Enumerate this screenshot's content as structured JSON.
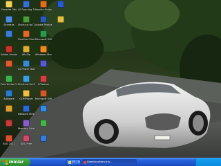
{
  "colors": {
    "taskbar": "#245edb",
    "start": "#3a9b3a",
    "tray": "#0c8ae0",
    "car": "#dcdcdc"
  },
  "desktop": {
    "icons": [
      {
        "label": "Favorite 08x",
        "icon": "folder-icon",
        "color": "#f3d35a"
      },
      {
        "label": "Secretos",
        "icon": "app-icon",
        "color": "#4a8de0"
      },
      {
        "label": "",
        "icon": "internet-explorer-icon",
        "color": "#3b7bd8"
      },
      {
        "label": "Adobe Acrobat 6 Professional",
        "icon": "acrobat-icon",
        "color": "#d0302a"
      },
      {
        "label": "",
        "icon": "app-icon",
        "color": "#e05a2a"
      },
      {
        "label": "Free Audio Converter",
        "icon": "audio-icon",
        "color": "#3bb24a"
      },
      {
        "label": "AdAware",
        "icon": "shield-icon",
        "color": "#2a7bd0"
      },
      {
        "label": "",
        "icon": "app-icon",
        "color": "#e0a030"
      },
      {
        "label": "",
        "icon": "app-icon",
        "color": "#c83a3a"
      },
      {
        "label": "AVG 2011",
        "icon": "avg-icon",
        "color": "#e05030"
      },
      {
        "label": "LS Running Tool",
        "icon": "tool-icon",
        "color": "#3a6fd0"
      },
      {
        "label": "Shortcut to QuickBook",
        "icon": "shortcut-icon",
        "color": "#4a9a3a"
      },
      {
        "label": "FlexSim Client",
        "icon": "app-icon",
        "color": "#e06a2a"
      },
      {
        "label": "WinZip",
        "icon": "winzip-icon",
        "color": "#d8b030"
      },
      {
        "label": "LS Power Tools",
        "icon": "tool-icon",
        "color": "#3a8ad0"
      },
      {
        "label": "Shortcut to MessengerSetup",
        "icon": "messenger-icon",
        "color": "#3aa0e0"
      },
      {
        "label": "GOMPlayer",
        "icon": "player-icon",
        "color": "#f0c040"
      },
      {
        "label": "Network Messenger",
        "icon": "network-icon",
        "color": "#2a6ad0"
      },
      {
        "label": "Memory Gbits",
        "icon": "memory-icon",
        "color": "#8a5ad0"
      },
      {
        "label": "ABC Free",
        "icon": "app-icon",
        "color": "#d04a6a"
      },
      {
        "label": "Mozilla Firefox",
        "icon": "firefox-icon",
        "color": "#e07020"
      },
      {
        "label": "Adobe Photoshop CS3",
        "icon": "photoshop-icon",
        "color": "#2a5ab0"
      },
      {
        "label": "Microsoft Office Exc...",
        "icon": "excel-icon",
        "color": "#2a9a4a"
      },
      {
        "label": "Windows Media Player",
        "icon": "media-player-icon",
        "color": "#f08a20"
      },
      {
        "label": "",
        "icon": "app-icon",
        "color": "#5a5ad0"
      },
      {
        "label": "CCleaner",
        "icon": "ccleaner-icon",
        "color": "#d04040"
      },
      {
        "label": "Microsoft Office Powe...",
        "icon": "powerpoint-icon",
        "color": "#d05a2a"
      },
      {
        "label": "",
        "icon": "app-icon",
        "color": "#3a8ae0"
      },
      {
        "label": "",
        "icon": "app-icon",
        "color": "#4ab04a"
      },
      {
        "label": "",
        "icon": "app-icon",
        "color": "#3a7ad0"
      },
      {
        "label": "",
        "icon": "word-icon",
        "color": "#2a5ad0"
      },
      {
        "label": "",
        "icon": "app-icon",
        "color": "#e0c040"
      }
    ]
  },
  "taskbar": {
    "start_label": "Iniciar",
    "tasks": [
      {
        "label": "29 . 11 . valenda - Wi...",
        "icon": "folder-icon",
        "color": "#f3d35a",
        "active": false
      },
      {
        "label": "Download/servicio...",
        "icon": "browser-icon",
        "color": "#e05030",
        "active": true
      }
    ]
  }
}
